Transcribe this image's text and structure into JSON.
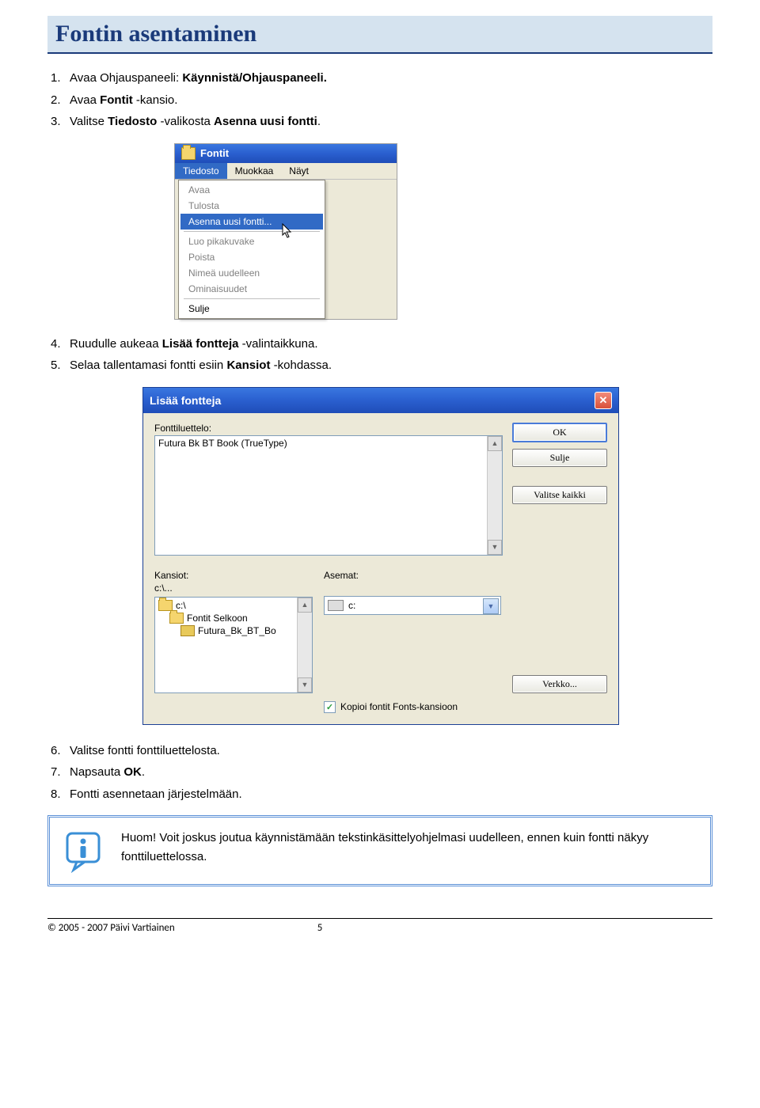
{
  "page_title": "Fontin asentaminen",
  "steps_block1": [
    {
      "num": "1.",
      "pre": "Avaa Ohjauspaneeli: ",
      "bold": "Käynnistä/Ohjauspaneeli.",
      "post": ""
    },
    {
      "num": "2.",
      "pre": "Avaa ",
      "bold": "Fontit",
      "post": " -kansio."
    },
    {
      "num": "3.",
      "pre": "Valitse ",
      "bold": "Tiedosto",
      "post": " -valikosta ",
      "bold2": "Asenna uusi fontti",
      "post2": "."
    }
  ],
  "steps_block2": [
    {
      "num": "4.",
      "pre": "Ruudulle aukeaa ",
      "bold": "Lisää fontteja",
      "post": " -valintaikkuna."
    },
    {
      "num": "5.",
      "pre": "Selaa tallentamasi fontti esiin ",
      "bold": "Kansiot",
      "post": " -kohdassa."
    }
  ],
  "steps_block3": [
    {
      "num": "6.",
      "pre": "Valitse fontti fonttiluettelosta."
    },
    {
      "num": "7.",
      "pre": "Napsauta ",
      "bold": "OK",
      "post": "."
    },
    {
      "num": "8.",
      "pre": "Fontti asennetaan järjestelmään."
    }
  ],
  "ss1": {
    "window_title": "Fontit",
    "menubar": [
      "Tiedosto",
      "Muokkaa",
      "Näyt"
    ],
    "menu_items": [
      {
        "label": "Avaa",
        "state": "disabled"
      },
      {
        "label": "Tulosta",
        "state": "disabled"
      },
      {
        "label": "Asenna uusi fontti...",
        "state": "selected"
      },
      {
        "sep": true
      },
      {
        "label": "Luo pikakuvake",
        "state": "disabled"
      },
      {
        "label": "Poista",
        "state": "disabled"
      },
      {
        "label": "Nimeä uudelleen",
        "state": "disabled"
      },
      {
        "label": "Ominaisuudet",
        "state": "disabled"
      },
      {
        "sep": true
      },
      {
        "label": "Sulje",
        "state": "enabled"
      }
    ]
  },
  "ss2": {
    "dialog_title": "Lisää fontteja",
    "fontlist_label": "Fonttiluettelo:",
    "fontlist_items": [
      "Futura Bk BT Book (TrueType)"
    ],
    "buttons": {
      "ok": "OK",
      "close": "Sulje",
      "select_all": "Valitse kaikki",
      "network": "Verkko..."
    },
    "folders_label": "Kansiot:",
    "folders_path": "c:\\...",
    "folder_tree": [
      {
        "label": "c:\\",
        "indent": 0,
        "open": true
      },
      {
        "label": "Fontit Selkoon",
        "indent": 1,
        "open": true
      },
      {
        "label": "Futura_Bk_BT_Bo",
        "indent": 2,
        "open": false
      }
    ],
    "drives_label": "Asemat:",
    "drive_selected": "c:",
    "copy_checkbox": {
      "checked": true,
      "label": "Kopioi fontit Fonts-kansioon"
    }
  },
  "info_box": "Huom! Voit joskus joutua käynnistämään tekstinkäsittelyohjelmasi uudelleen, ennen kuin fontti näkyy fonttiluettelossa.",
  "footer": {
    "copyright": "© 2005 - 2007 Päivi Vartiainen",
    "page": "5"
  }
}
